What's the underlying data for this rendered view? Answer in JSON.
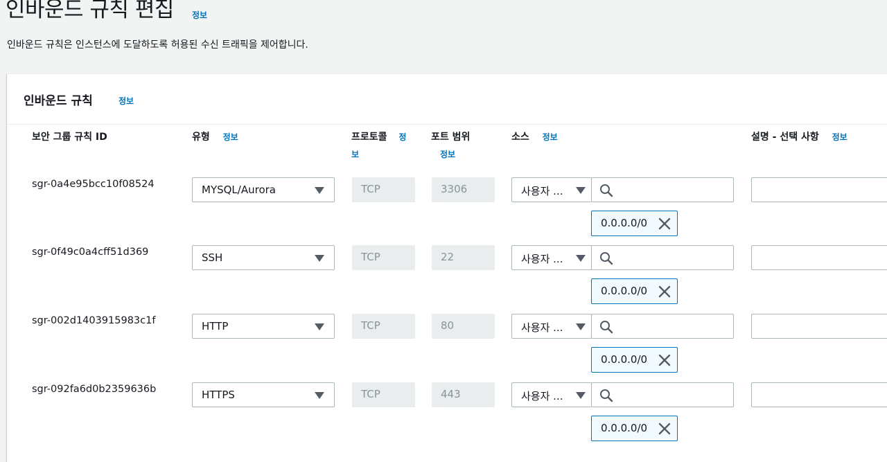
{
  "page": {
    "title": "인바운드 규칙 편집",
    "title_info": "정보",
    "description": "인바운드 규칙은 인스턴스에 도달하도록 허용된 수신 트래픽을 제어합니다."
  },
  "panel": {
    "title": "인바운드 규칙",
    "info": "정보"
  },
  "columns": {
    "rule_id": "보안 그룹 규칙 ID",
    "type": "유형",
    "type_info": "정보",
    "protocol_part1": "프로토콜",
    "protocol_info_a": "정",
    "protocol_info_b": "보",
    "port": "포트 범위",
    "port_info": "정보",
    "source": "소스",
    "source_info": "정보",
    "description": "설명 - 선택 사항",
    "description_info": "정보"
  },
  "rules": [
    {
      "id": "sgr-0a4e95bcc10f08524",
      "type": "MYSQL/Aurora",
      "protocol": "TCP",
      "port": "3306",
      "source_type": "사용자 ...",
      "token": "0.0.0.0/0"
    },
    {
      "id": "sgr-0f49c0a4cff51d369",
      "type": "SSH",
      "protocol": "TCP",
      "port": "22",
      "source_type": "사용자 ...",
      "token": "0.0.0.0/0"
    },
    {
      "id": "sgr-002d1403915983c1f",
      "type": "HTTP",
      "protocol": "TCP",
      "port": "80",
      "source_type": "사용자 ...",
      "token": "0.0.0.0/0"
    },
    {
      "id": "sgr-092fa6d0b2359636b",
      "type": "HTTPS",
      "protocol": "TCP",
      "port": "443",
      "source_type": "사용자 ...",
      "token": "0.0.0.0/0"
    }
  ],
  "icons": {
    "select_caret": "caret-down-icon",
    "search": "search-icon",
    "remove_token": "close-icon"
  },
  "colors": {
    "link": "#0073bb",
    "page_bg": "#f2f3f3",
    "token_border": "#0073bb",
    "token_bg": "#f1faff"
  }
}
